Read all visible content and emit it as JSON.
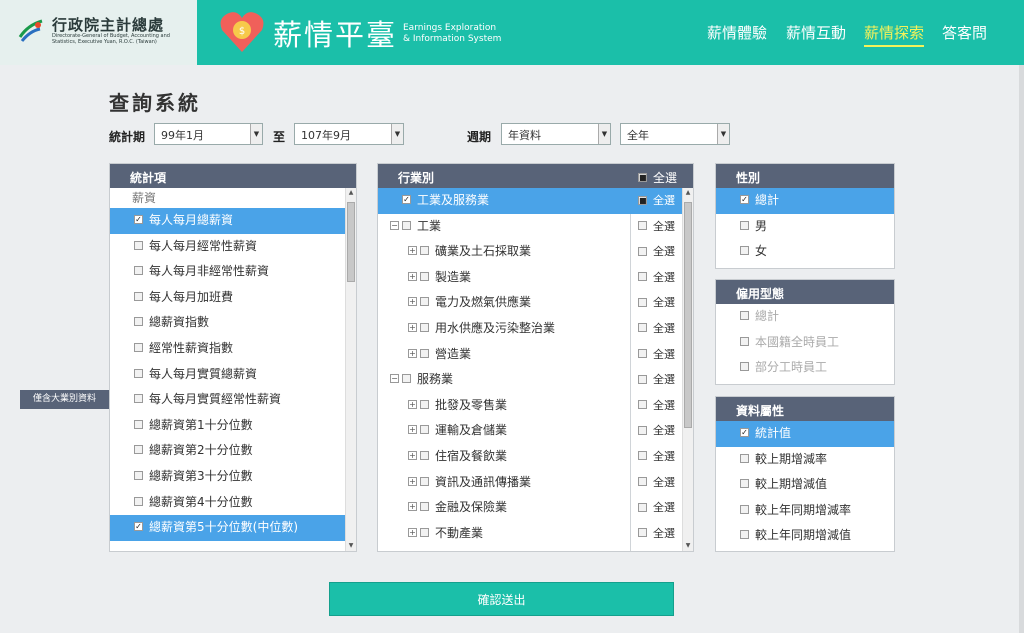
{
  "header": {
    "logo_cn": "行政院主計總處",
    "logo_en": "Directorate-General of Budget, Accounting and Statistics, Executive Yuan, R.O.C. (Taiwan)",
    "brand_title": "薪情平臺",
    "brand_sub_1": "Earnings Exploration",
    "brand_sub_2": "& Information System",
    "nav": [
      "薪情體驗",
      "薪情互動",
      "薪情探索",
      "答客問"
    ],
    "active_nav": "薪情探索",
    "accent": "#1bbfa9",
    "active_color": "#f4f25a"
  },
  "page_title": "查詢系統",
  "filters": {
    "period_label": "統計期",
    "from_value": "99年1月",
    "to_label": "至",
    "to_value": "107年9月",
    "cycle_label": "週期",
    "cycle_value": "年資料",
    "range_value": "全年"
  },
  "stats_panel": {
    "title": "統計項",
    "group": "薪資",
    "items": [
      {
        "label": "每人每月總薪資",
        "checked": true
      },
      {
        "label": "每人每月經常性薪資",
        "checked": false
      },
      {
        "label": "每人每月非經常性薪資",
        "checked": false
      },
      {
        "label": "每人每月加班費",
        "checked": false
      },
      {
        "label": "總薪資指數",
        "checked": false
      },
      {
        "label": "經常性薪資指數",
        "checked": false
      },
      {
        "label": "每人每月實質總薪資",
        "checked": false
      },
      {
        "label": "每人每月實質經常性薪資",
        "checked": false
      },
      {
        "label": "總薪資第1十分位數",
        "checked": false
      },
      {
        "label": "總薪資第2十分位數",
        "checked": false
      },
      {
        "label": "總薪資第3十分位數",
        "checked": false
      },
      {
        "label": "總薪資第4十分位數",
        "checked": false
      },
      {
        "label": "總薪資第5十分位數(中位數)",
        "checked": true
      }
    ]
  },
  "side_tab": "僅含大業別資料",
  "industry_panel": {
    "title": "行業別",
    "select_all": "全選",
    "items": [
      {
        "label": "工業及服務業",
        "checked": true,
        "level": 0,
        "expander": "",
        "all": "全選",
        "all_checked": true
      },
      {
        "label": "工業",
        "checked": false,
        "level": 0,
        "expander": "−",
        "all": "全選",
        "all_checked": false
      },
      {
        "label": "礦業及土石採取業",
        "checked": false,
        "level": 1,
        "expander": "+",
        "all": "全選",
        "all_checked": false
      },
      {
        "label": "製造業",
        "checked": false,
        "level": 1,
        "expander": "+",
        "all": "全選",
        "all_checked": false
      },
      {
        "label": "電力及燃氣供應業",
        "checked": false,
        "level": 1,
        "expander": "+",
        "all": "全選",
        "all_checked": false
      },
      {
        "label": "用水供應及污染整治業",
        "checked": false,
        "level": 1,
        "expander": "+",
        "all": "全選",
        "all_checked": false
      },
      {
        "label": "營造業",
        "checked": false,
        "level": 1,
        "expander": "+",
        "all": "全選",
        "all_checked": false
      },
      {
        "label": "服務業",
        "checked": false,
        "level": 0,
        "expander": "−",
        "all": "全選",
        "all_checked": false
      },
      {
        "label": "批發及零售業",
        "checked": false,
        "level": 1,
        "expander": "+",
        "all": "全選",
        "all_checked": false
      },
      {
        "label": "運輸及倉儲業",
        "checked": false,
        "level": 1,
        "expander": "+",
        "all": "全選",
        "all_checked": false
      },
      {
        "label": "住宿及餐飲業",
        "checked": false,
        "level": 1,
        "expander": "+",
        "all": "全選",
        "all_checked": false
      },
      {
        "label": "資訊及通訊傳播業",
        "checked": false,
        "level": 1,
        "expander": "+",
        "all": "全選",
        "all_checked": false
      },
      {
        "label": "金融及保險業",
        "checked": false,
        "level": 1,
        "expander": "+",
        "all": "全選",
        "all_checked": false
      },
      {
        "label": "不動產業",
        "checked": false,
        "level": 1,
        "expander": "+",
        "all": "全選",
        "all_checked": false
      }
    ]
  },
  "gender_panel": {
    "title": "性別",
    "items": [
      {
        "label": "總計",
        "checked": true
      },
      {
        "label": "男",
        "checked": false
      },
      {
        "label": "女",
        "checked": false
      }
    ]
  },
  "employ_panel": {
    "title": "僱用型態",
    "items": [
      {
        "label": "總計",
        "checked": false
      },
      {
        "label": "本國籍全時員工",
        "checked": false
      },
      {
        "label": "部分工時員工",
        "checked": false
      }
    ]
  },
  "attr_panel": {
    "title": "資料屬性",
    "items": [
      {
        "label": "統計值",
        "checked": true
      },
      {
        "label": "較上期增減率",
        "checked": false
      },
      {
        "label": "較上期增減值",
        "checked": false
      },
      {
        "label": "較上年同期增減率",
        "checked": false
      },
      {
        "label": "較上年同期增減值",
        "checked": false
      }
    ]
  },
  "submit_label": "確認送出"
}
